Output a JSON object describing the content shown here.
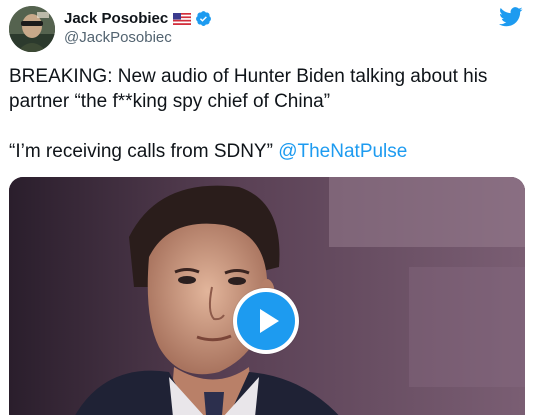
{
  "author": {
    "display_name": "Jack Posobiec",
    "handle": "@JackPosobiec",
    "flag_icon": "us-flag-icon",
    "verified_icon": "verified-badge-icon",
    "verified_color": "#1d9bf0"
  },
  "brand": {
    "icon": "twitter-bird-icon",
    "color": "#1d9bf0"
  },
  "tweet": {
    "text_line1": "BREAKING: New audio of Hunter Biden talking about his partner “the f**king spy chief of China”",
    "text_line2": "“I’m receiving calls from SDNY” ",
    "mention": "@TheNatPulse",
    "mention_color": "#1d9bf0"
  },
  "media": {
    "type": "video",
    "play_icon": "play-icon",
    "play_color": "#1d9bf0"
  }
}
